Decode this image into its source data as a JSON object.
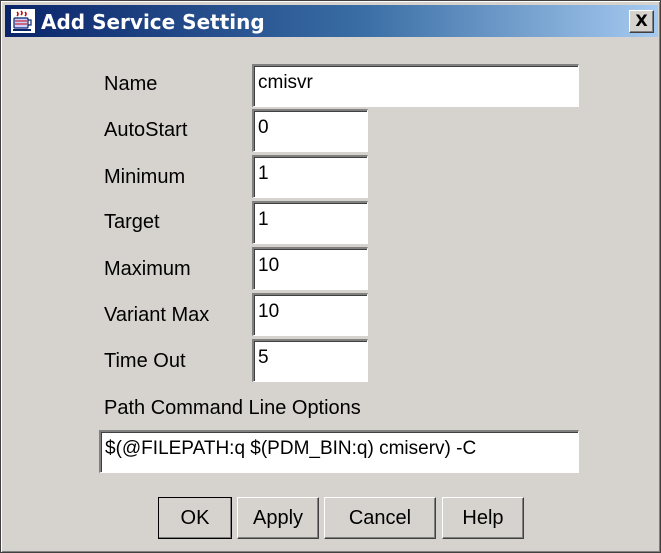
{
  "window": {
    "title": "Add Service Setting",
    "close_label": "X"
  },
  "fields": {
    "name": {
      "label": "Name",
      "value": "cmisvr"
    },
    "autostart": {
      "label": "AutoStart",
      "value": "0"
    },
    "minimum": {
      "label": "Minimum",
      "value": "1"
    },
    "target": {
      "label": "Target",
      "value": "1"
    },
    "maximum": {
      "label": "Maximum",
      "value": "10"
    },
    "variant_max": {
      "label": "Variant Max",
      "value": "10"
    },
    "time_out": {
      "label": "Time Out",
      "value": "5"
    }
  },
  "path_options": {
    "label": "Path Command Line Options",
    "value": "$(@FILEPATH:q $(PDM_BIN:q) cmiserv) -C"
  },
  "buttons": {
    "ok": "OK",
    "apply": "Apply",
    "cancel": "Cancel",
    "help": "Help"
  },
  "colors": {
    "title_gradient_start": "#0a246a",
    "title_gradient_end": "#a6caf0",
    "dialog_bg": "#d6d3ce"
  },
  "icons": {
    "title": "app-coffee-cup-icon",
    "close": "close-icon"
  }
}
